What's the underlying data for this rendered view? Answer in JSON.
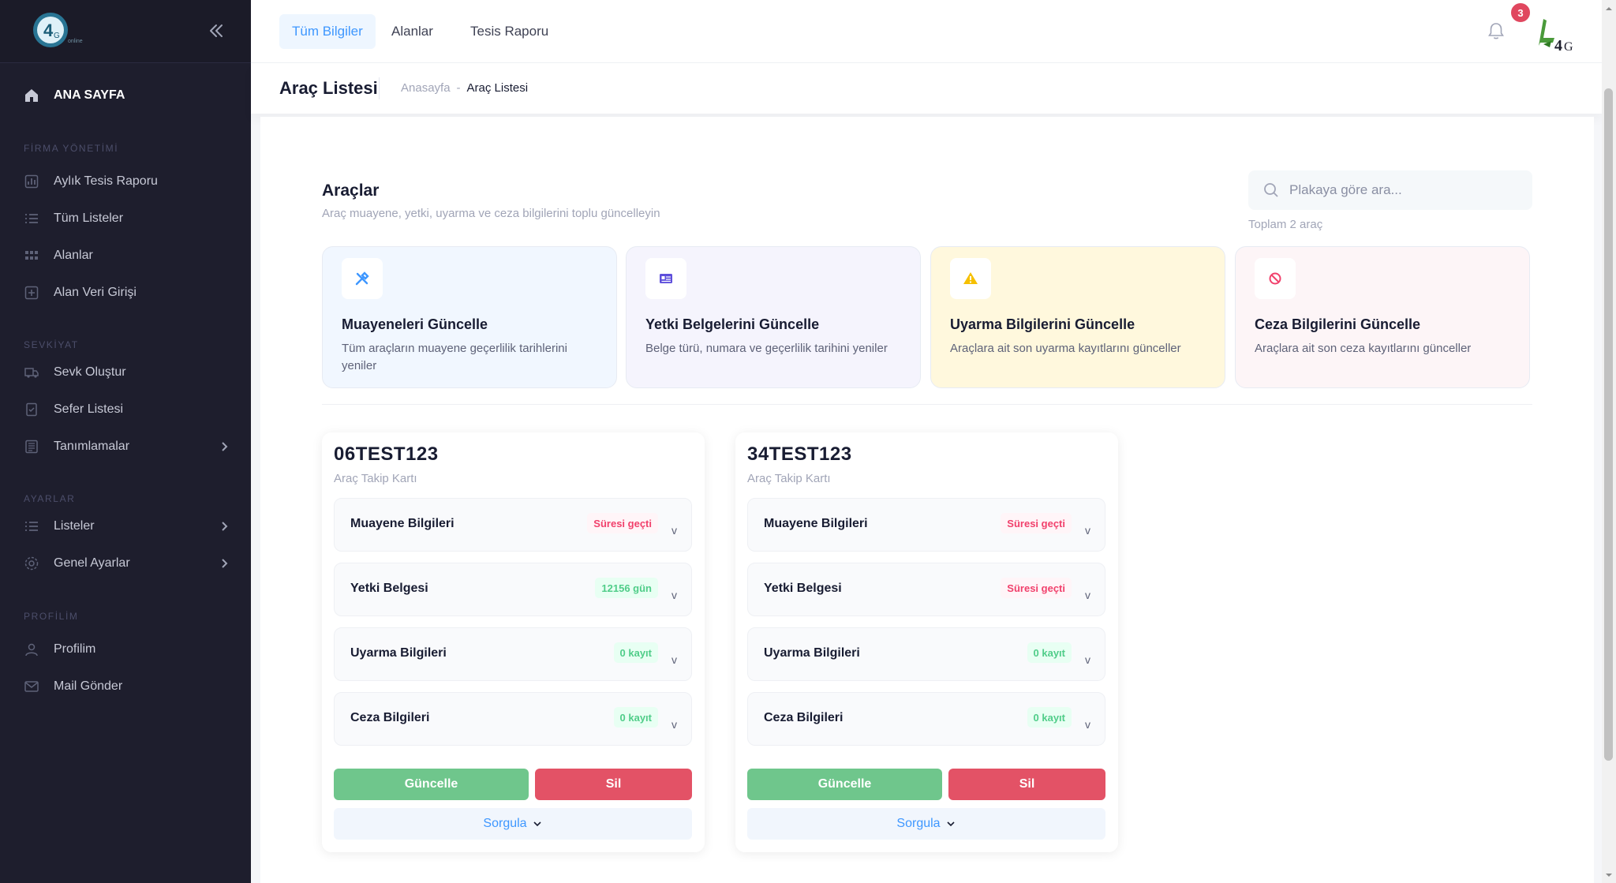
{
  "sidebar": {
    "home_label": "ANA SAYFA",
    "sections": {
      "firma": "FİRMA YÖNETİMİ",
      "sevkiyat": "SEVKİYAT",
      "ayarlar": "AYARLAR",
      "profilim": "PROFİLİM"
    },
    "items": {
      "aylik": "Aylık Tesis Raporu",
      "tum_listeler": "Tüm Listeler",
      "alanlar": "Alanlar",
      "alan_veri": "Alan Veri Girişi",
      "sevk": "Sevk Oluştur",
      "sefer": "Sefer Listesi",
      "tanimlamalar": "Tanımlamalar",
      "listeler": "Listeler",
      "genel": "Genel Ayarlar",
      "profilim": "Profilim",
      "mail": "Mail Gönder"
    }
  },
  "topbar": {
    "tabs": [
      "Tüm Bilgiler",
      "Alanlar",
      "Tesis Raporu"
    ],
    "notification_count": "3"
  },
  "header": {
    "title": "Araç Listesi",
    "breadcrumb_home": "Anasayfa",
    "breadcrumb_sep": "-",
    "breadcrumb_current": "Araç Listesi"
  },
  "main": {
    "title": "Araçlar",
    "subtitle": "Araç muayene, yetki, uyarma ve ceza bilgilerini toplu güncelleyin",
    "search_placeholder": "Plakaya göre ara...",
    "total": "Toplam 2 araç"
  },
  "actions": [
    {
      "title": "Muayeneleri Güncelle",
      "desc": "Tüm araçların muayene geçerlilik tarihlerini yeniler",
      "bg": "#f1f7ff",
      "icon": "wrench-icon",
      "color": "#3e97ff"
    },
    {
      "title": "Yetki Belgelerini Güncelle",
      "desc": "Belge türü, numara ve geçerlilik tarihini yeniler",
      "bg": "#f5f4fd",
      "icon": "id-card-icon",
      "color": "#5e4fdb"
    },
    {
      "title": "Uyarma Bilgilerini Güncelle",
      "desc": "Araçlara ait son uyarma kayıtlarını günceller",
      "bg": "#fff8dd",
      "icon": "warning-icon",
      "color": "#f6c000"
    },
    {
      "title": "Ceza Bilgilerini Güncelle",
      "desc": "Araçlara ait son ceza kayıtlarını günceller",
      "bg": "#fdf5f7",
      "icon": "ban-icon",
      "color": "#f1416c"
    }
  ],
  "vehicles": [
    {
      "plate": "06TEST123",
      "subtitle": "Araç Takip Kartı",
      "rows": [
        {
          "label": "Muayene Bilgileri",
          "status": "Süresi geçti",
          "tone": "red"
        },
        {
          "label": "Yetki Belgesi",
          "status": "12156 gün",
          "tone": "green"
        },
        {
          "label": "Uyarma Bilgileri",
          "status": "0 kayıt",
          "tone": "green"
        },
        {
          "label": "Ceza Bilgileri",
          "status": "0 kayıt",
          "tone": "green"
        }
      ],
      "update_label": "Güncelle",
      "delete_label": "Sil",
      "query_label": "Sorgula"
    },
    {
      "plate": "34TEST123",
      "subtitle": "Araç Takip Kartı",
      "rows": [
        {
          "label": "Muayene Bilgileri",
          "status": "Süresi geçti",
          "tone": "red"
        },
        {
          "label": "Yetki Belgesi",
          "status": "Süresi geçti",
          "tone": "red"
        },
        {
          "label": "Uyarma Bilgileri",
          "status": "0 kayıt",
          "tone": "green"
        },
        {
          "label": "Ceza Bilgileri",
          "status": "0 kayıt",
          "tone": "green"
        }
      ],
      "update_label": "Güncelle",
      "delete_label": "Sil",
      "query_label": "Sorgula"
    }
  ],
  "colors": {
    "sidebar_bg": "#1e1e2d",
    "primary": "#3e97ff",
    "success": "#6fc68c",
    "danger": "#e35266"
  }
}
